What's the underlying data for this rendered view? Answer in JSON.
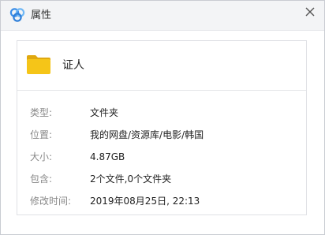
{
  "dialog": {
    "title": "属性",
    "icons": {
      "app_logo": "baidu-netdisk-logo",
      "close": "close-icon",
      "item": "folder-icon"
    },
    "colors": {
      "folder": "#f5c518",
      "folder_tab": "#e0a80f",
      "logo_primary": "#3a8de8",
      "logo_secondary": "#6fb7f5"
    }
  },
  "item": {
    "name": "证人"
  },
  "properties": [
    {
      "label": "类型:",
      "value": "文件夹"
    },
    {
      "label": "位置:",
      "value": "我的网盘/资源库/电影/韩国"
    },
    {
      "label": "大小:",
      "value": "4.87GB"
    },
    {
      "label": "包含:",
      "value": "2个文件,0个文件夹"
    },
    {
      "label": "修改时间:",
      "value": "2019年08月25日, 22:13"
    }
  ]
}
